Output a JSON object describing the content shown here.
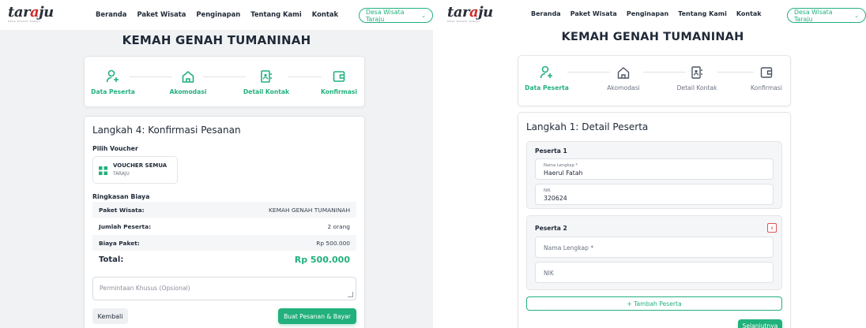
{
  "brand": {
    "logo_dark": "tar",
    "logo_red": "a",
    "logo_dark2": "ju",
    "tagline": "DESA WISATA TARAJU"
  },
  "nav": {
    "items": [
      "Beranda",
      "Paket Wisata",
      "Penginapan",
      "Tentang Kami",
      "Kontak"
    ],
    "dropdown": "Desa Wisata Taraju"
  },
  "package_title": "KEMAH GENAH TUMANINAH",
  "steps": [
    "Data Peserta",
    "Akomodasi",
    "Detail Kontak",
    "Konfirmasi"
  ],
  "left": {
    "heading": "Langkah 4: Konfirmasi Pesanan",
    "voucher_label": "Pilih Voucher",
    "voucher_name": "VOUCHER SEMUA",
    "voucher_sub": "TARAJU",
    "summary_label": "Ringkasan Biaya",
    "summary": [
      {
        "k": "Paket Wisata:",
        "v": "KEMAH GENAH TUMANINAH"
      },
      {
        "k": "Jumlah Peserta:",
        "v": "2 orang"
      },
      {
        "k": "Biaya Paket:",
        "v": "Rp 500.000"
      }
    ],
    "total_label": "Total:",
    "total_value": "Rp 500.000",
    "notes_placeholder": "Permintaan Khusus (Opsional)",
    "back_label": "Kembali",
    "submit_label": "Buat Pesanan & Bayar"
  },
  "right": {
    "heading": "Langkah 1: Detail Peserta",
    "p1_title": "Peserta 1",
    "p1_name_label": "Nama Lengkap *",
    "p1_name_value": "Haerul Fatah",
    "p1_nik_label": "NIK",
    "p1_nik_value": "320624",
    "p2_title": "Peserta 2",
    "p2_remove": "x",
    "p2_name_placeholder": "Nama Lengkap *",
    "p2_nik_placeholder": "NIK",
    "add_label": "+ Tambah Peserta",
    "next_label": "Selanjutnya"
  },
  "colors": {
    "accent": "#22b07d",
    "danger": "#e05252",
    "text": "#1f2937"
  },
  "icons": [
    "user-plus-icon",
    "home-icon",
    "contact-book-icon",
    "wallet-icon",
    "voucher-icon",
    "resize-handle-icon"
  ]
}
